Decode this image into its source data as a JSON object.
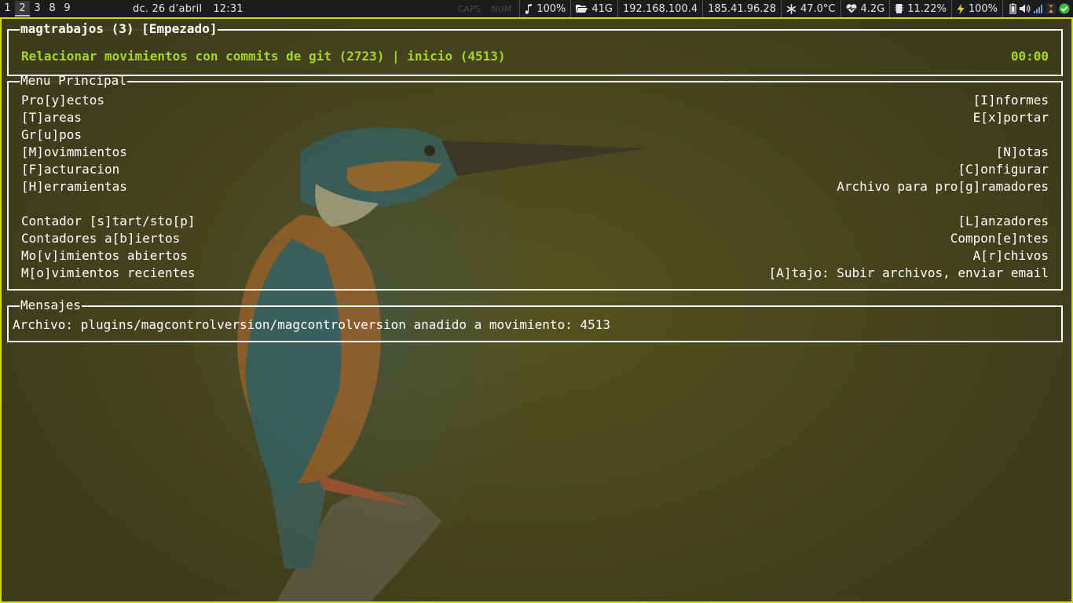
{
  "topbar": {
    "workspaces": [
      "1",
      "2",
      "3",
      "8",
      "9"
    ],
    "active_workspace_index": 1,
    "date": "dc. 26 d’abril",
    "time": "12:31",
    "caps_indicator": "CAPS",
    "num_indicator": "NUM",
    "volume": "100%",
    "disk": "41G",
    "local_ip": "192.168.100.4",
    "public_ip": "185.41.96.28",
    "temperature": "47.0°C",
    "memory": "4.2G",
    "cpu": "11.22%",
    "battery": "100%",
    "icons": {
      "volume": "music-note-icon",
      "disk": "folder-icon",
      "temperature": "snowflake-icon",
      "memory": "heart-pulse-icon",
      "cpu": "chip-icon",
      "battery": "lightning-icon",
      "tray": [
        "battery-tray-icon",
        "speaker-tray-icon",
        "wifi-signal-icon",
        "network-tray-icon",
        "check-circle-icon"
      ]
    },
    "colors": {
      "bar_bg": "#1c1c1c",
      "check": "#3dbb3d",
      "lightning": "#e8d33a"
    }
  },
  "work_box": {
    "title": "magtrabajos (3) [Empezado]",
    "current_task": "Relacionar movimientos con commits de git (2723) | inicio (4513)",
    "timer": "00:00",
    "accent_color": "#a8d42a"
  },
  "menu_box": {
    "title": "Menu Principal",
    "left_group1": [
      "Pro[y]ectos",
      "[T]areas",
      "Gr[u]pos",
      "[M]ovimmientos",
      "[F]acturacion",
      "[H]erramientas"
    ],
    "left_group2": [
      "Contador [s]tart/sto[p]",
      "Contadores a[b]iertos",
      "Mo[v]imientos abiertos",
      "M[o]vimientos recientes"
    ],
    "right_group1": [
      "[I]nformes",
      "E[x]portar",
      "",
      "[N]otas",
      "[C]onfigurar",
      "Archivo para pro[g]ramadores"
    ],
    "right_group2": [
      "[L]anzadores",
      "Compon[e]ntes",
      "A[r]chivos",
      "[A]tajo: Subir archivos, enviar email"
    ]
  },
  "messages_box": {
    "title": "Mensajes",
    "message": "Archivo: plugins/magcontrolversion/magcontrolversion anadido a movimiento: 4513"
  },
  "terminal": {
    "border_color": "#d6d61a",
    "background_color": "#46451e"
  }
}
